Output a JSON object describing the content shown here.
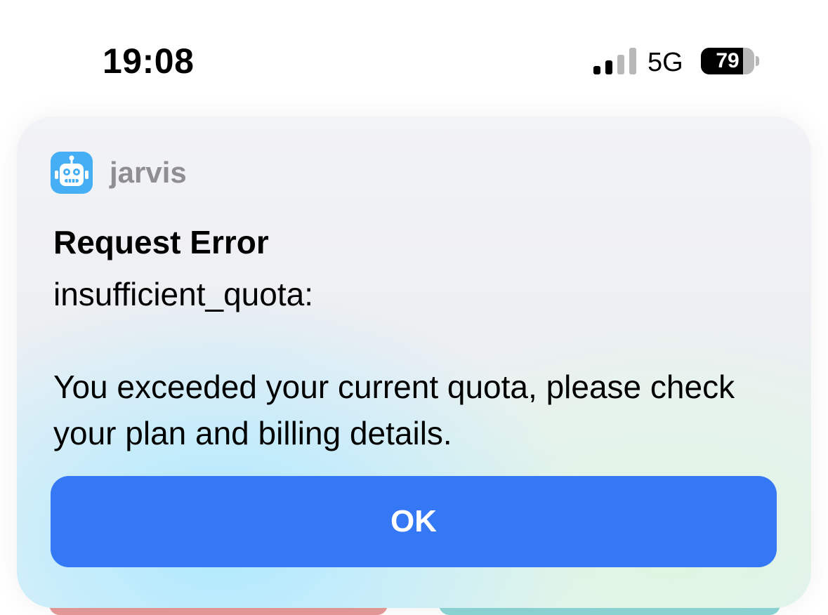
{
  "status_bar": {
    "time": "19:08",
    "network": "5G",
    "battery_level": "79",
    "battery_fraction": 0.79,
    "signal_bars_active": 2,
    "signal_bars_total": 4
  },
  "notification": {
    "app_name": "jarvis",
    "app_icon": "robot-icon",
    "title": "Request Error",
    "message": "insufficient_quota:\n\nYou exceeded your current quota, please check your plan and billing details.",
    "button_label": "OK"
  },
  "colors": {
    "accent": "#3478f6",
    "app_icon_bg": "#45aef5",
    "secondary_text": "#8e8e93"
  }
}
